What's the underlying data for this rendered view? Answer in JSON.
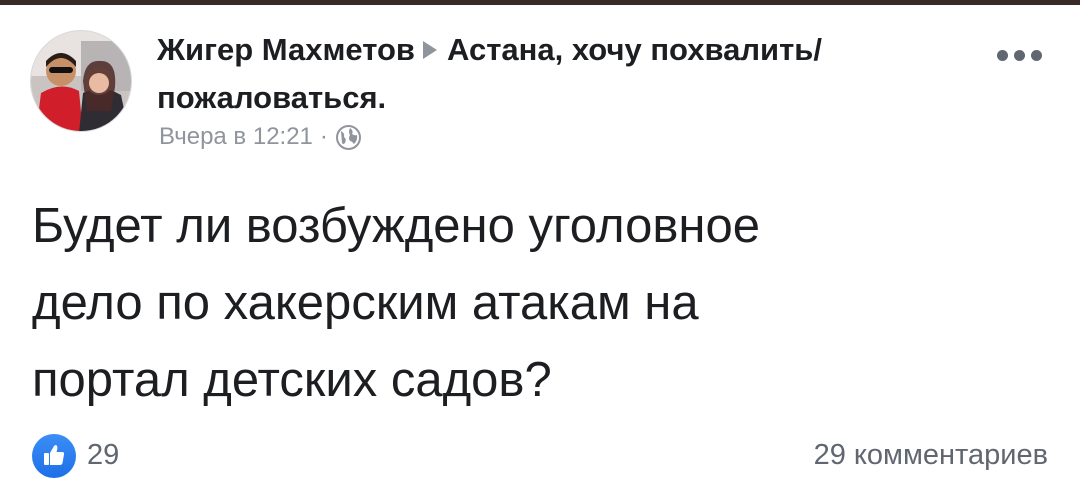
{
  "post": {
    "author": "Жигер Махметов",
    "group": "Астана, хочу похвалить/ пожаловаться.",
    "timestamp": "Вчера в 12:21",
    "separator": "·",
    "privacy_icon": "globe-icon",
    "text_lines": [
      "Будет ли возбуждено уголовное",
      "дело по хакерским атакам на",
      "портал детских садов?"
    ],
    "like_count": "29",
    "comments_label": "29 комментариев",
    "more_icon": "more-dots-icon"
  },
  "colors": {
    "text_primary": "#1c1e21",
    "text_secondary": "#90949c",
    "like_blue": "#1e6fe8"
  }
}
